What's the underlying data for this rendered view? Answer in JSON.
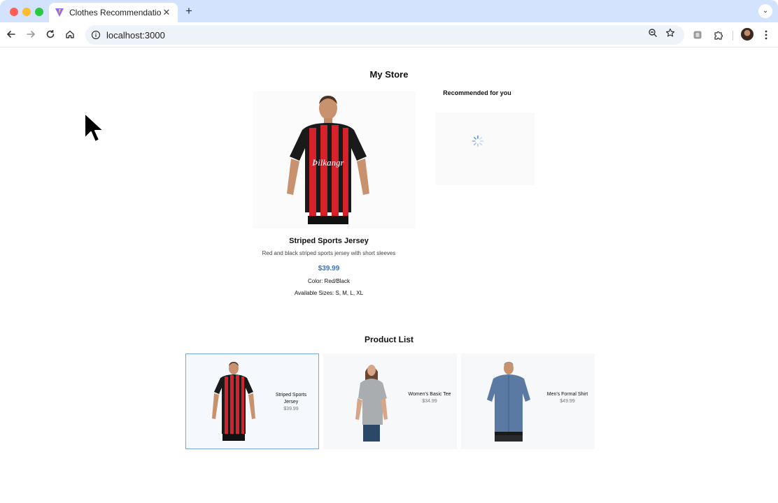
{
  "browser": {
    "tab_title": "Clothes Recommendation",
    "url": "localhost:3000"
  },
  "page": {
    "store_title": "My Store",
    "featured": {
      "name": "Striped Sports Jersey",
      "description": "Red and black striped sports jersey with short sleeves",
      "price": "$39.99",
      "color": "Color: Red/Black",
      "sizes": "Available Sizes: S, M, L, XL"
    },
    "recommended_title": "Recommended for you",
    "product_list_title": "Product List",
    "products": [
      {
        "name": "Striped Sports Jersey",
        "price": "$39.99",
        "selected": true
      },
      {
        "name": "Women's Basic Tee",
        "price": "$34.99",
        "selected": false
      },
      {
        "name": "Men's Formal Shirt",
        "price": "$49.99",
        "selected": false
      }
    ]
  },
  "colors": {
    "tabstrip": "#d3e3fd",
    "price_accent": "#3b73c4",
    "selected_border": "#7aa7db"
  },
  "icons": {
    "back": "arrow-left-icon",
    "forward": "arrow-right-icon",
    "reload": "reload-icon",
    "home": "home-icon",
    "site_info": "info-icon",
    "zoom": "zoom-icon",
    "bookmark": "star-icon",
    "extension": "puzzle-icon",
    "menu": "kebab-menu-icon"
  }
}
